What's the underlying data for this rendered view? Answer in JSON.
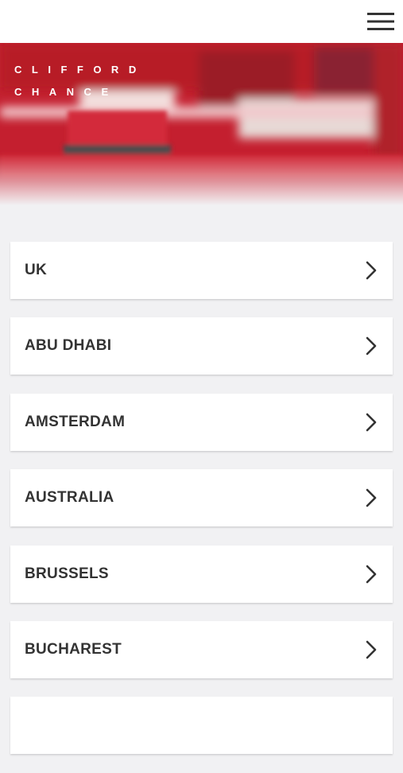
{
  "header": {
    "menu_icon": "hamburger-menu-icon"
  },
  "hero": {
    "logo_line1": "CLIFFORD",
    "logo_line2": "CHANCE",
    "colors": {
      "red": "#c61f2e",
      "dark": "#3a3a3a"
    }
  },
  "offices": {
    "chevron_icon": "chevron-right-icon",
    "items": [
      {
        "label": "UK"
      },
      {
        "label": "ABU DHABI"
      },
      {
        "label": "AMSTERDAM"
      },
      {
        "label": "AUSTRALIA"
      },
      {
        "label": "BRUSSELS"
      },
      {
        "label": "BUCHAREST"
      },
      {
        "label": ""
      }
    ]
  }
}
